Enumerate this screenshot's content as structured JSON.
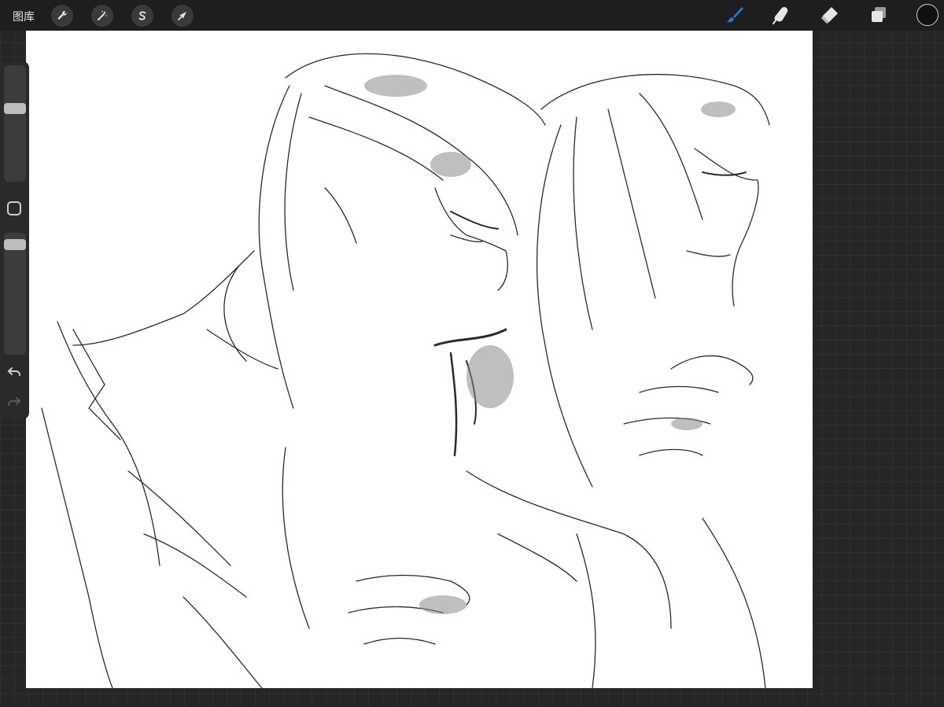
{
  "topbar": {
    "gallery_label": "图库",
    "left_tools": [
      {
        "icon": "wrench-icon",
        "name": "actions"
      },
      {
        "icon": "magic-wand-icon",
        "name": "adjustments"
      },
      {
        "icon": "selection-s-icon",
        "name": "selection"
      },
      {
        "icon": "arrow-cursor-icon",
        "name": "transform"
      }
    ],
    "right_tools": [
      {
        "icon": "brush-icon",
        "name": "paint",
        "active": true
      },
      {
        "icon": "smudge-icon",
        "name": "smudge"
      },
      {
        "icon": "eraser-icon",
        "name": "eraser"
      },
      {
        "icon": "layers-icon",
        "name": "layers"
      },
      {
        "icon": "color-circle-icon",
        "name": "color"
      }
    ],
    "active_color": "#1e7ad6"
  },
  "sidebar": {
    "brush_size_level": 0.35,
    "opacity_level": 0.05,
    "icons": [
      "modify-square-icon",
      "undo-icon",
      "redo-icon"
    ]
  },
  "canvas": {
    "content": "pencil-sketch-artwork"
  }
}
